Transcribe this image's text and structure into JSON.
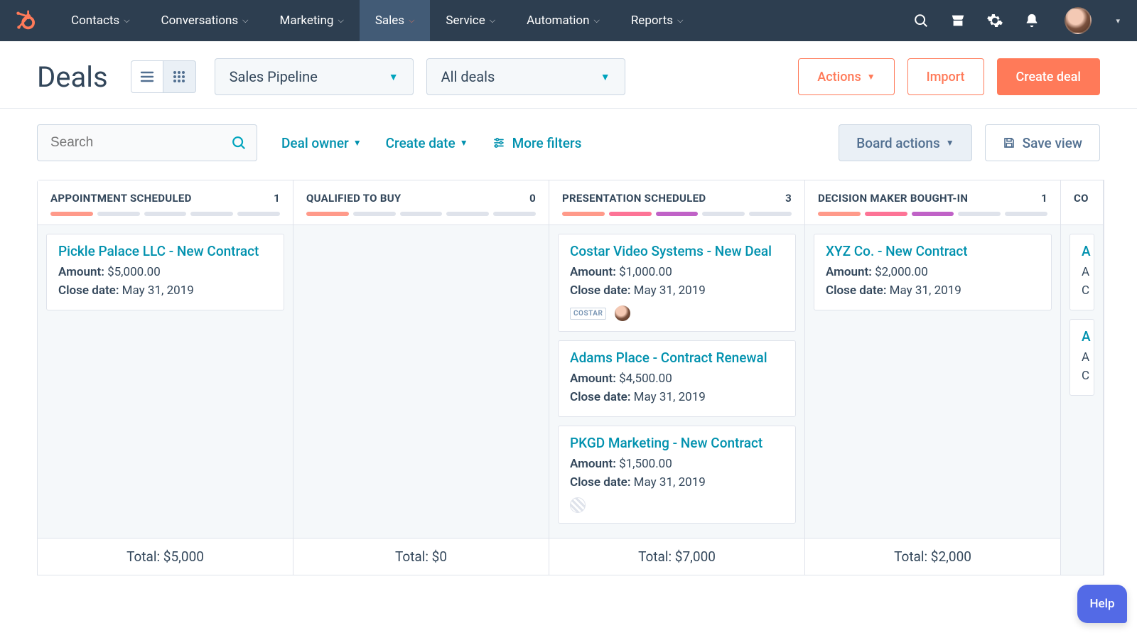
{
  "nav": {
    "items": [
      {
        "label": "Contacts"
      },
      {
        "label": "Conversations"
      },
      {
        "label": "Marketing"
      },
      {
        "label": "Sales",
        "active": true,
        "orange_caret": true
      },
      {
        "label": "Service"
      },
      {
        "label": "Automation"
      },
      {
        "label": "Reports"
      }
    ]
  },
  "header": {
    "title": "Deals",
    "pipeline_select": "Sales Pipeline",
    "scope_select": "All deals",
    "actions_btn": "Actions",
    "import_btn": "Import",
    "create_btn": "Create deal"
  },
  "filters": {
    "search_placeholder": "Search",
    "owner": "Deal owner",
    "create_date": "Create date",
    "more": "More filters",
    "board_actions": "Board actions",
    "save_view": "Save view"
  },
  "board": {
    "amount_label": "Amount:",
    "close_label": "Close date:",
    "total_label": "Total:",
    "columns": [
      {
        "name": "APPOINTMENT SCHEDULED",
        "count": 1,
        "color_segments": 1,
        "total": "$5,000",
        "cards": [
          {
            "title": "Pickle Palace LLC - New Contract",
            "amount": "$5,000.00",
            "close": "May 31, 2019"
          }
        ]
      },
      {
        "name": "QUALIFIED TO BUY",
        "count": 0,
        "color_segments": 1,
        "total": "$0",
        "cards": []
      },
      {
        "name": "PRESENTATION SCHEDULED",
        "count": 3,
        "color_segments": 3,
        "total": "$7,000",
        "cards": [
          {
            "title": "Costar Video Systems - New Deal",
            "amount": "$1,000.00",
            "close": "May 31, 2019",
            "avatars": true,
            "company": "COSTAR"
          },
          {
            "title": "Adams Place - Contract Renewal",
            "amount": "$4,500.00",
            "close": "May 31, 2019"
          },
          {
            "title": "PKGD Marketing - New Contract",
            "amount": "$1,500.00",
            "close": "May 31, 2019",
            "stripe": true
          }
        ]
      },
      {
        "name": "DECISION MAKER BOUGHT-IN",
        "count": 1,
        "color_segments": 3,
        "total": "$2,000",
        "cards": [
          {
            "title": "XYZ Co. - New Contract",
            "amount": "$2,000.00",
            "close": "May 31, 2019"
          }
        ]
      },
      {
        "name": "CO",
        "count": "",
        "color_segments": 0,
        "total": "",
        "cut": true,
        "cards": [
          {
            "title": "A",
            "amount_short": "A",
            "close_short": "C"
          },
          {
            "title": "A",
            "amount_short": "A",
            "close_short": "C"
          }
        ]
      }
    ]
  },
  "help": {
    "label": "Help"
  }
}
